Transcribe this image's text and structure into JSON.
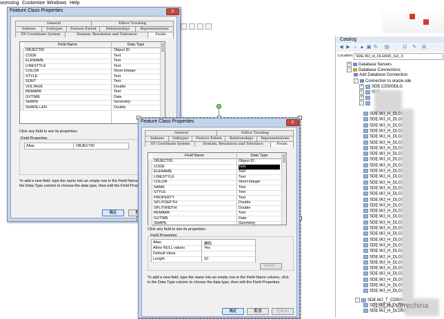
{
  "menubar": {
    "items": [
      "ocessing",
      "Customize",
      "Windows",
      "Help"
    ]
  },
  "catalog": {
    "title": "Catalog",
    "location_label": "Location:",
    "location_value": "SDE.WJ_H_DLG500_GX_X",
    "tree": {
      "database_servers": "Database Servers",
      "database_connections": "Database Connections",
      "add_database_connection": "Add Database Connection",
      "connection_oracle": "Connection to oracle.sde",
      "sde_cd500dlg": "SDE.CD500DLG",
      "sde_partial": "SDE",
      "items": [
        "SDE.WJ_H_DLG5",
        "SDE.WJ_H_DLG5",
        "SDE.WJ_H_DLG5",
        "SDE.WJ_H_DLG5",
        "SDE.WJ_H_DLG5",
        "SDE.WJ_H_DLG5",
        "SDE.WJ_H_DLG5",
        "SDE.WJ_H_DLG5",
        "SDE.WJ_H_DLG5",
        "SDE.WJ_H_DLG5",
        "SDE.WJ_H_DLG5",
        "SDE.WJ_H_DLG5",
        "SDE.WJ_H_DLG5",
        "SDE.WJ_H_DLG5",
        "SDE.WJ_H_DLG5",
        "SDE.WJ_H_DLG5",
        "SDE.WJ_H_DLG5",
        "SDE.WJ_H_DLG5",
        "SDE.WJ_H_DLG5",
        "SDE.WJ_H_DLG5",
        "SDE.WJ_H_DLG5",
        "SDE.WJ_H_DLG5",
        "SDE.WJ_H_DLG5",
        "SDE.WJ_H_DLG5",
        "SDE.WJ_H_DLG5",
        "SDE.WJ_H_DLG5",
        "SDE.WJ_H_DLG5",
        "SDE.WJ_H_DLG5",
        "SDE.WJ_H_DLG5",
        "SDE.WJ_H_DLG5",
        "SDE.WJ_H_DLG5",
        "SDE.WJ_H_DLG5"
      ],
      "sde_wj_t": "SDE.WJ_T_CD500D",
      "sde_wj_h_dlg500": "SDE.WJ_H_DLG500"
    }
  },
  "dialog1": {
    "title": "Feature Class Properties",
    "close_label": "X",
    "tabs_row1": [
      "General",
      "Editor Tracking"
    ],
    "tabs_row2": [
      "Indexes",
      "Subtypes",
      "Feature Extent",
      "Relationships",
      "Representations"
    ],
    "tabs_row3": [
      "XY Coordinate System",
      "Domain, Resolution and Tolerance",
      "Fields"
    ],
    "columns": [
      "Field Name",
      "Data Type"
    ],
    "rows": [
      [
        "OBJECTID",
        "Object ID"
      ],
      [
        "CODE",
        "Text"
      ],
      [
        "ELENAME",
        "Text"
      ],
      [
        "LINESTYLE",
        "Text"
      ],
      [
        "COLOR",
        "Short Integer"
      ],
      [
        "STYLE",
        "Text"
      ],
      [
        "SORT",
        "Text"
      ],
      [
        "VOLTAGE",
        "Double"
      ],
      [
        "REMARK",
        "Text"
      ],
      [
        "GXTIME",
        "Date"
      ],
      [
        "SHAPE",
        "Geometry"
      ],
      [
        "SHAPE.LEN",
        "Double"
      ]
    ],
    "hint": "Click any field to see its properties.",
    "field_properties_label": "Field Properties",
    "prop_rows": [
      [
        "Alias",
        "OBJECTID"
      ]
    ],
    "instructions_line1": "To add a new field, type the name into an empty row in the Field Name colum",
    "instructions_line2": "the Data Type column to choose the data type, then edit the Field Propertie",
    "ok_label": "确定",
    "cancel_label": "取消"
  },
  "dialog2": {
    "title": "Feature Class Properties",
    "close_label": "X",
    "tabs_row1": [
      "General",
      "Editor Tracking"
    ],
    "tabs_row2": [
      "Indexes",
      "Subtypes",
      "Feature Extent",
      "Relationships",
      "Representations"
    ],
    "tabs_row3": [
      "XY Coordinate System",
      "Domain, Resolution and Tolerance",
      "Fields"
    ],
    "columns": [
      "Field Name",
      "Data Type"
    ],
    "rows": [
      [
        "OBJECTID",
        "Object ID"
      ],
      [
        "CODE",
        "Text"
      ],
      [
        "ELENAME",
        "Text"
      ],
      [
        "LINESTYLE",
        "Text"
      ],
      [
        "COLOR",
        "Short Integer"
      ],
      [
        "NAME",
        "Text"
      ],
      [
        "STYLE",
        "Text"
      ],
      [
        "PROPERTY",
        "Text"
      ],
      [
        "SPLITDEPTH",
        "Double"
      ],
      [
        "SPLITWIDTH",
        "Double"
      ],
      [
        "REMARK",
        "Text"
      ],
      [
        "GXTIME",
        "Date"
      ],
      [
        "SHAPE",
        "Geometry"
      ]
    ],
    "hint": "Click any field to see its properties.",
    "field_properties_label": "Field Properties",
    "prop_rows": [
      [
        "Alias",
        "编码"
      ],
      [
        "Allow NULL values",
        "Yes"
      ],
      [
        "Default Value",
        ""
      ],
      [
        "Length",
        "10"
      ]
    ],
    "import_label": "Import...",
    "instructions_line1": "To add a new field, type the name into an empty row in the Field Name column, click",
    "instructions_line2": "in the Data Type column to choose the data type, then edit the Field Properties.",
    "ok_label": "确定",
    "cancel_label": "取消",
    "apply_label": "应用(A)"
  },
  "watermark": "CSDN @rechina"
}
